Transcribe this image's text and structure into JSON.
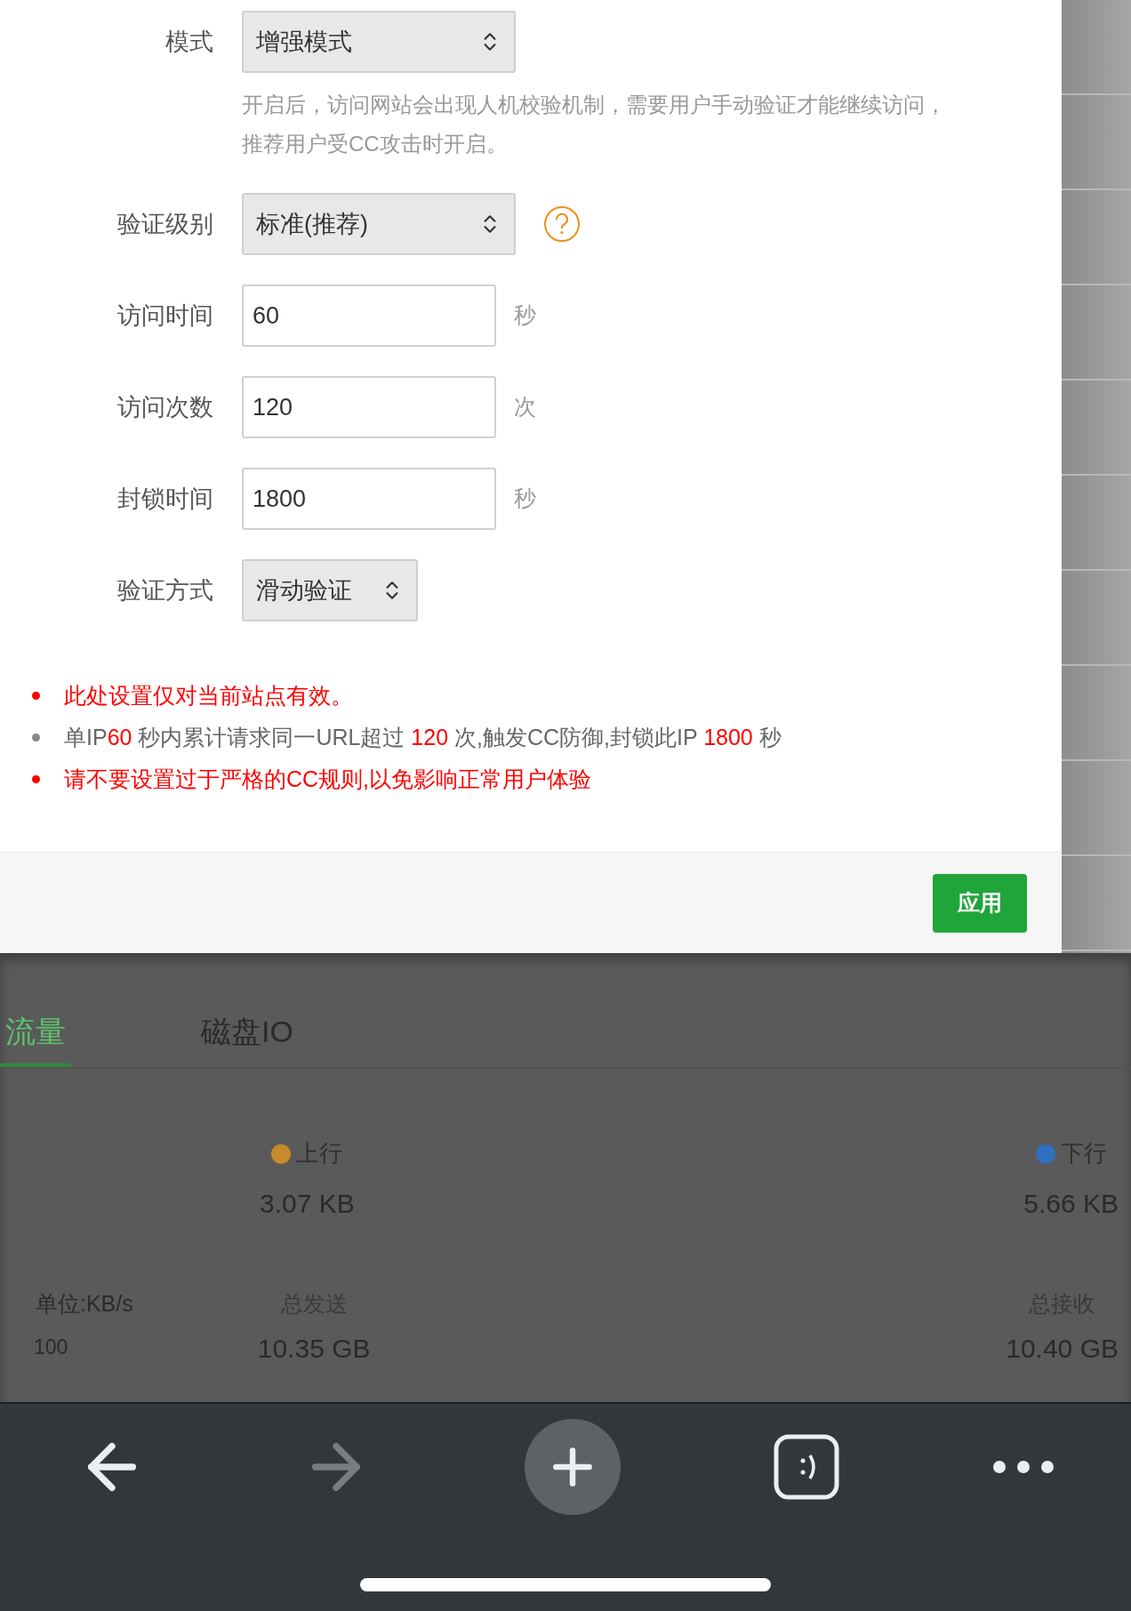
{
  "form": {
    "rows": [
      {
        "kind": "select",
        "label": "模式",
        "value": "增强模式",
        "help_text": "开启后，访问网站会出现人机校验机制，需要用户手动验证才能继续访问，推荐用户受CC攻击时开启。"
      },
      {
        "kind": "select",
        "label": "验证级别",
        "value": "标准(推荐)",
        "has_help_icon": true
      },
      {
        "kind": "input",
        "label": "访问时间",
        "value": "60",
        "unit": "秒"
      },
      {
        "kind": "input",
        "label": "访问次数",
        "value": "120",
        "unit": "次"
      },
      {
        "kind": "input",
        "label": "封锁时间",
        "value": "1800",
        "unit": "秒"
      },
      {
        "kind": "select",
        "label": "验证方式",
        "value": "滑动验证"
      }
    ]
  },
  "notes": [
    {
      "kind": "warning",
      "segments": [
        {
          "text": "此处设置仅对当前站点有效。",
          "highlight": true
        }
      ]
    },
    {
      "kind": "info",
      "segments": [
        {
          "text": "单IP",
          "highlight": false
        },
        {
          "text": "60",
          "highlight": true
        },
        {
          "text": " 秒内累计请求同一URL超过 ",
          "highlight": false
        },
        {
          "text": "120",
          "highlight": true
        },
        {
          "text": " 次,触发CC防御,封锁此IP ",
          "highlight": false
        },
        {
          "text": "1800",
          "highlight": true
        },
        {
          "text": " 秒",
          "highlight": false
        }
      ]
    },
    {
      "kind": "warning",
      "segments": [
        {
          "text": "请不要设置过于严格的CC规则,以免影响正常用户体验",
          "highlight": true
        }
      ]
    }
  ],
  "footer": {
    "apply_button": "应用"
  },
  "background_page": {
    "tabs": [
      {
        "label": "流量",
        "selected": true
      },
      {
        "label": "磁盘IO",
        "selected": false
      }
    ],
    "stats": [
      {
        "legend": "上行",
        "color": "#c88a2a",
        "value": "3.07 KB",
        "total_label": "总发送",
        "total": "10.35 GB"
      },
      {
        "legend": "下行",
        "color": "#2f6fc0",
        "value": "5.66 KB",
        "total_label": "总接收",
        "total": "10.40 GB"
      }
    ],
    "unit": "单位:KB/s",
    "y_tick": "100"
  },
  "browser_toolbar": {
    "items": [
      {
        "kind": "back",
        "disabled": false
      },
      {
        "kind": "forward",
        "disabled": true
      },
      {
        "kind": "new-tab",
        "disabled": false
      },
      {
        "kind": "tabs",
        "disabled": false
      },
      {
        "kind": "more",
        "disabled": false
      }
    ]
  }
}
